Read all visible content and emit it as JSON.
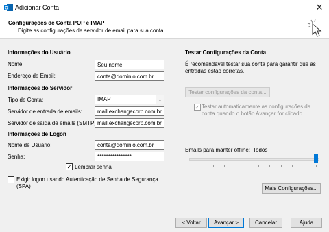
{
  "window": {
    "title": "Adicionar Conta",
    "close_symbol": "✕"
  },
  "header": {
    "title": "Configurações de Conta POP e IMAP",
    "subtitle": "Digite as configurações de servidor de email para sua conta."
  },
  "user_info": {
    "section_title": "Informações do Usuário",
    "name_label": "Nome:",
    "name_value": "Seu nome",
    "email_label": "Endereço de Email:",
    "email_value": "conta@dominio.com.br"
  },
  "server_info": {
    "section_title": "Informações do Servidor",
    "account_type_label": "Tipo de Conta:",
    "account_type_value": "IMAP",
    "incoming_label": "Servidor de entrada de emails:",
    "incoming_value": "mail.exchangecorp.com.br",
    "outgoing_label": "Servidor de saída de emails (SMTP):",
    "outgoing_value": "mail.exchangecorp.com.br"
  },
  "logon_info": {
    "section_title": "Informações de Logon",
    "username_label": "Nome de Usuário:",
    "username_value": "conta@dominio.com.br",
    "password_label": "Senha:",
    "password_value": "****************",
    "remember_label": "Lembrar senha",
    "remember_checked": true,
    "spa_label_line1": "Exigir logon usando Autenticação de Senha de Segurança",
    "spa_label_line2": "(SPA)",
    "spa_checked": false
  },
  "test_panel": {
    "title": "Testar Configurações da Conta",
    "desc_line1": "É recomendável testar sua conta para garantir que as",
    "desc_line2": "entradas estão corretas.",
    "test_button": "Testar configurações da conta...",
    "auto_test_line1": "Testar automaticamente as configurações da",
    "auto_test_line2": "conta quando o botão Avançar for clicado",
    "auto_test_checked": true
  },
  "offline": {
    "label": "Emails para manter offline:",
    "value": "Todos",
    "slider_level": 1.0
  },
  "buttons": {
    "more_settings": "Mais Configurações...",
    "back": "< Voltar",
    "next": "Avançar >",
    "cancel": "Cancelar",
    "help": "Ajuda"
  },
  "colors": {
    "accent": "#0078d7",
    "background": "#f0f0f0"
  }
}
